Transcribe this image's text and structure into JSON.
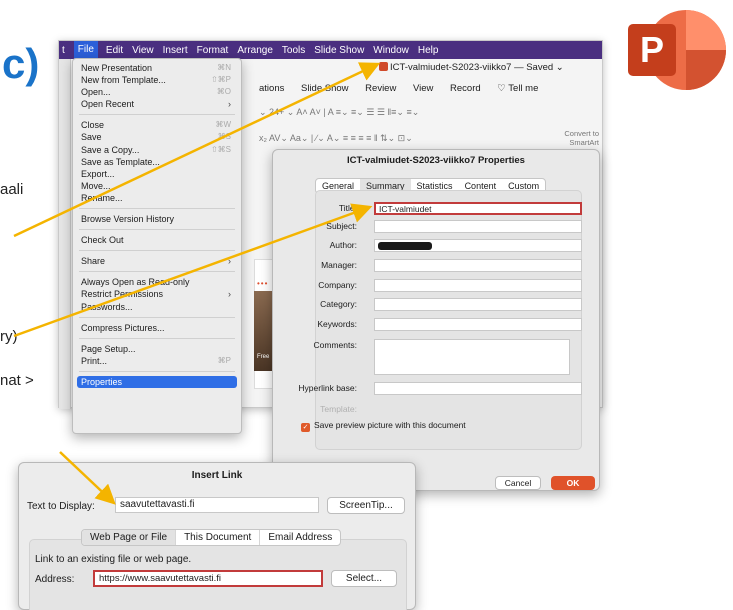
{
  "background": {
    "paren": "c)",
    "fragments": [
      "aali",
      "ry)",
      "nat >"
    ]
  },
  "menubar": {
    "items": [
      "t",
      "File",
      "Edit",
      "View",
      "Insert",
      "Format",
      "Arrange",
      "Tools",
      "Slide Show",
      "Window",
      "Help"
    ]
  },
  "ppt": {
    "doc_title": "ICT-valmiudet-S2023-viikko7 — Saved ⌄",
    "ribbon_tabs": [
      "ations",
      "Slide Show",
      "Review",
      "View",
      "Record",
      "♡ Tell me"
    ],
    "convert_label": "Convert to SmartArt",
    "slide_text": "Free"
  },
  "file_menu": {
    "items": [
      {
        "label": "New Presentation",
        "shortcut": "⌘N"
      },
      {
        "label": "New from Template...",
        "shortcut": "⇧⌘P"
      },
      {
        "label": "Open...",
        "shortcut": "⌘O"
      },
      {
        "label": "Open Recent",
        "arrow": "›"
      },
      {
        "sep": true
      },
      {
        "label": "Close",
        "shortcut": "⌘W"
      },
      {
        "label": "Save",
        "shortcut": "⌘S"
      },
      {
        "label": "Save a Copy...",
        "shortcut": "⇧⌘S"
      },
      {
        "label": "Save as Template..."
      },
      {
        "label": "Export..."
      },
      {
        "label": "Move..."
      },
      {
        "label": "Rename..."
      },
      {
        "sep": true
      },
      {
        "label": "Browse Version History"
      },
      {
        "sep": true
      },
      {
        "label": "Check Out"
      },
      {
        "sep": true
      },
      {
        "label": "Share",
        "arrow": "›"
      },
      {
        "sep": true
      },
      {
        "label": "Always Open as Read-only"
      },
      {
        "label": "Restrict Permissions",
        "arrow": "›"
      },
      {
        "label": "Passwords..."
      },
      {
        "sep": true
      },
      {
        "label": "Compress Pictures..."
      },
      {
        "sep": true
      },
      {
        "label": "Page Setup..."
      },
      {
        "label": "Print...",
        "shortcut": "⌘P"
      },
      {
        "sep": true
      },
      {
        "label": "Properties",
        "highlighted": true
      }
    ]
  },
  "properties": {
    "title": "ICT-valmiudet-S2023-viikko7 Properties",
    "tabs": [
      "General",
      "Summary",
      "Statistics",
      "Content",
      "Custom"
    ],
    "selected_tab": "Summary",
    "fields": {
      "title_label": "Title:",
      "title_value": "ICT-valmiudet",
      "subject_label": "Subject:",
      "subject_value": "",
      "author_label": "Author:",
      "manager_label": "Manager:",
      "manager_value": "",
      "company_label": "Company:",
      "company_value": "",
      "category_label": "Category:",
      "category_value": "",
      "keywords_label": "Keywords:",
      "keywords_value": "",
      "comments_label": "Comments:",
      "hyperlink_label": "Hyperlink base:",
      "hyperlink_value": "",
      "template_label": "Template:"
    },
    "save_preview": "Save preview picture with this document",
    "save_preview_checked": true,
    "cancel": "Cancel",
    "ok": "OK"
  },
  "insert_link": {
    "title": "Insert Link",
    "text_to_display_label": "Text to Display:",
    "text_to_display_value": "saavutettavasti.fi",
    "screentip": "ScreenTip...",
    "tabs": [
      "Web Page or File",
      "This Document",
      "Email Address"
    ],
    "selected_tab": "Web Page or File",
    "info": "Link to an existing file or web page.",
    "address_label": "Address:",
    "address_value": "https://www.saavutettavasti.fi",
    "select": "Select..."
  },
  "colors": {
    "menubar": "#4a2f80",
    "highlight": "#2f6ee6",
    "arrow": "#f4b400",
    "ok": "#e0522a",
    "field_highlight": "#c23b3b",
    "powerpoint": "#c43e1c"
  },
  "icons": [
    "powerpoint-logo-icon",
    "checkbox-checked-icon",
    "chevron-right-icon"
  ]
}
